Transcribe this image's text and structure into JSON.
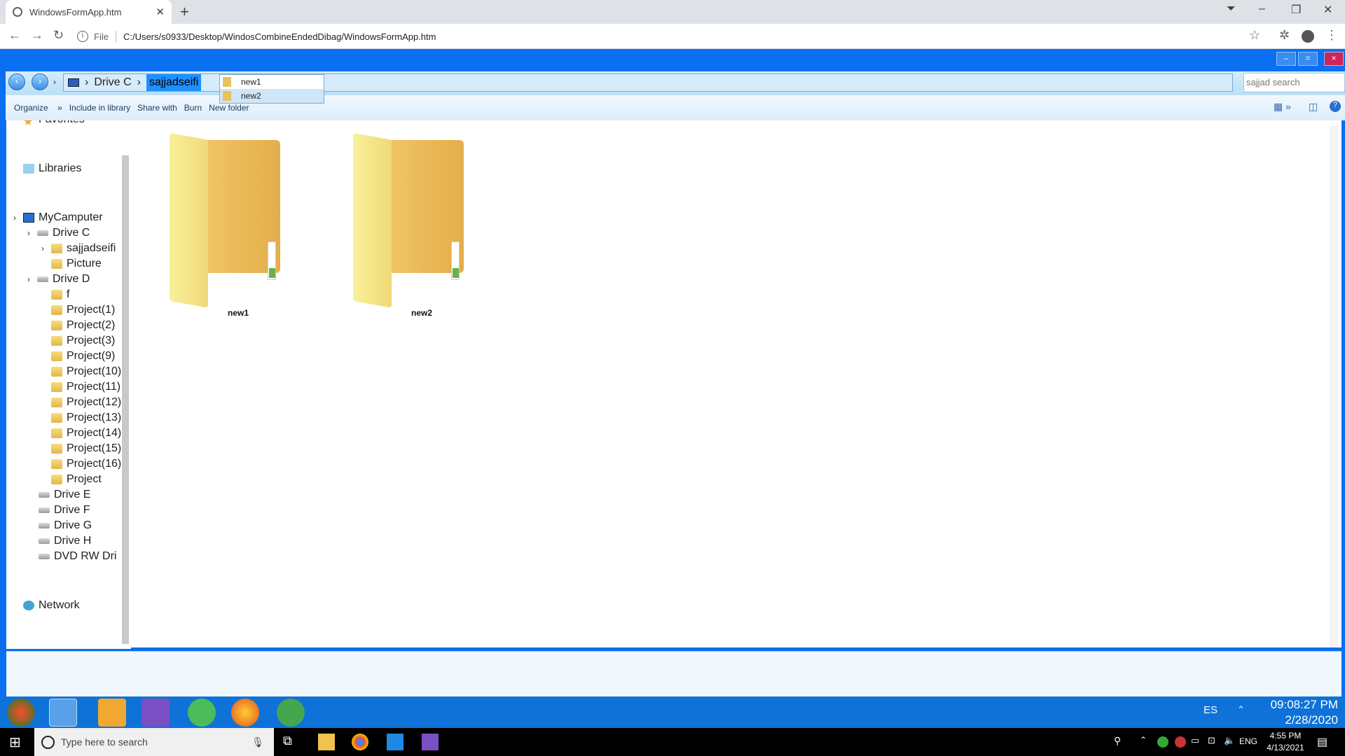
{
  "browser": {
    "tab_title": "WindowsFormApp.htm",
    "address_scheme": "File",
    "url": "C:/Users/s0933/Desktop/WindosCombineEndedDibag/WindowsFormApp.htm"
  },
  "app": {
    "caption_buttons": [
      "–",
      "=",
      "×"
    ],
    "breadcrumb": [
      "Drive C",
      "sajjadseifi"
    ],
    "dropdown": [
      "new1",
      "new2"
    ],
    "search_placeholder": "sajjad search",
    "commands": [
      "Organize",
      "Include in library",
      "Share with",
      "Burn",
      "New folder"
    ],
    "nav": {
      "favorites": "Favorites",
      "libraries": "Libraries",
      "computer": "MyCamputer",
      "drive_c": "Drive C",
      "c_children": [
        "sajjadseifi",
        "Picture"
      ],
      "drive_d": "Drive D",
      "d_children": [
        "f",
        "Project(1)",
        "Project(2)",
        "Project(3)",
        "Project(9)",
        "Project(10)",
        "Project(11)",
        "Project(12)",
        "Project(13)",
        "Project(14)",
        "Project(15)",
        "Project(16)",
        "Project"
      ],
      "other_drives": [
        "Drive E",
        "Drive F",
        "Drive G",
        "Drive H",
        "DVD RW Dri"
      ],
      "network": "Network"
    },
    "folders": [
      "new1",
      "new2"
    ]
  },
  "old_taskbar": {
    "lang": "ES",
    "time": "09:08:27 PM",
    "date": "2/28/2020"
  },
  "windows_taskbar": {
    "search_placeholder": "Type here to search",
    "lang": "ENG",
    "time": "4:55 PM",
    "date": "4/13/2021"
  }
}
